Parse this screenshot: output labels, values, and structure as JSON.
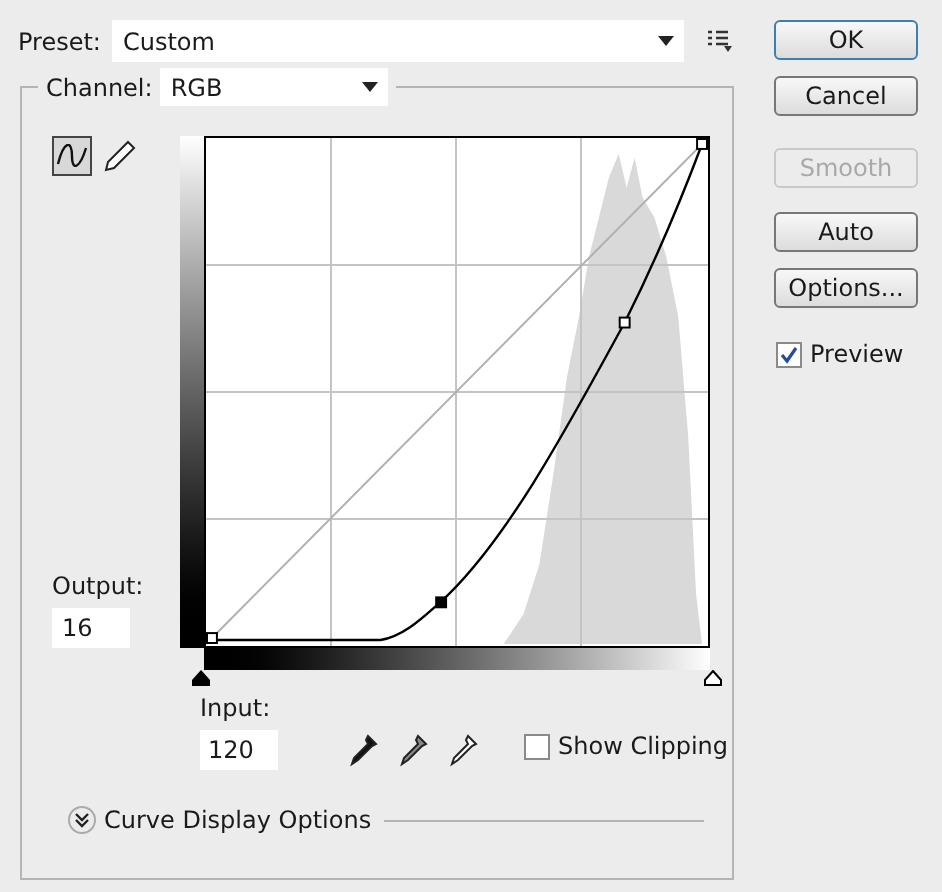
{
  "preset": {
    "label": "Preset:",
    "value": "Custom"
  },
  "channel": {
    "label": "Channel:",
    "value": "RGB"
  },
  "tools": [
    {
      "kind": "curve",
      "selected": true
    },
    {
      "kind": "pencil",
      "selected": false
    }
  ],
  "output": {
    "label": "Output:",
    "value": "16"
  },
  "input": {
    "label": "Input:",
    "value": "120"
  },
  "show_clipping": {
    "label": "Show Clipping",
    "checked": false
  },
  "curve_display_options": {
    "label": "Curve Display Options",
    "expanded": false
  },
  "buttons": [
    {
      "label": "OK",
      "disabled": false,
      "default": true
    },
    {
      "label": "Cancel",
      "disabled": false
    },
    {
      "label": "Smooth",
      "disabled": true
    },
    {
      "label": "Auto",
      "disabled": false
    },
    {
      "label": "Options...",
      "disabled": false
    }
  ],
  "preview": {
    "label": "Preview",
    "checked": true
  }
}
